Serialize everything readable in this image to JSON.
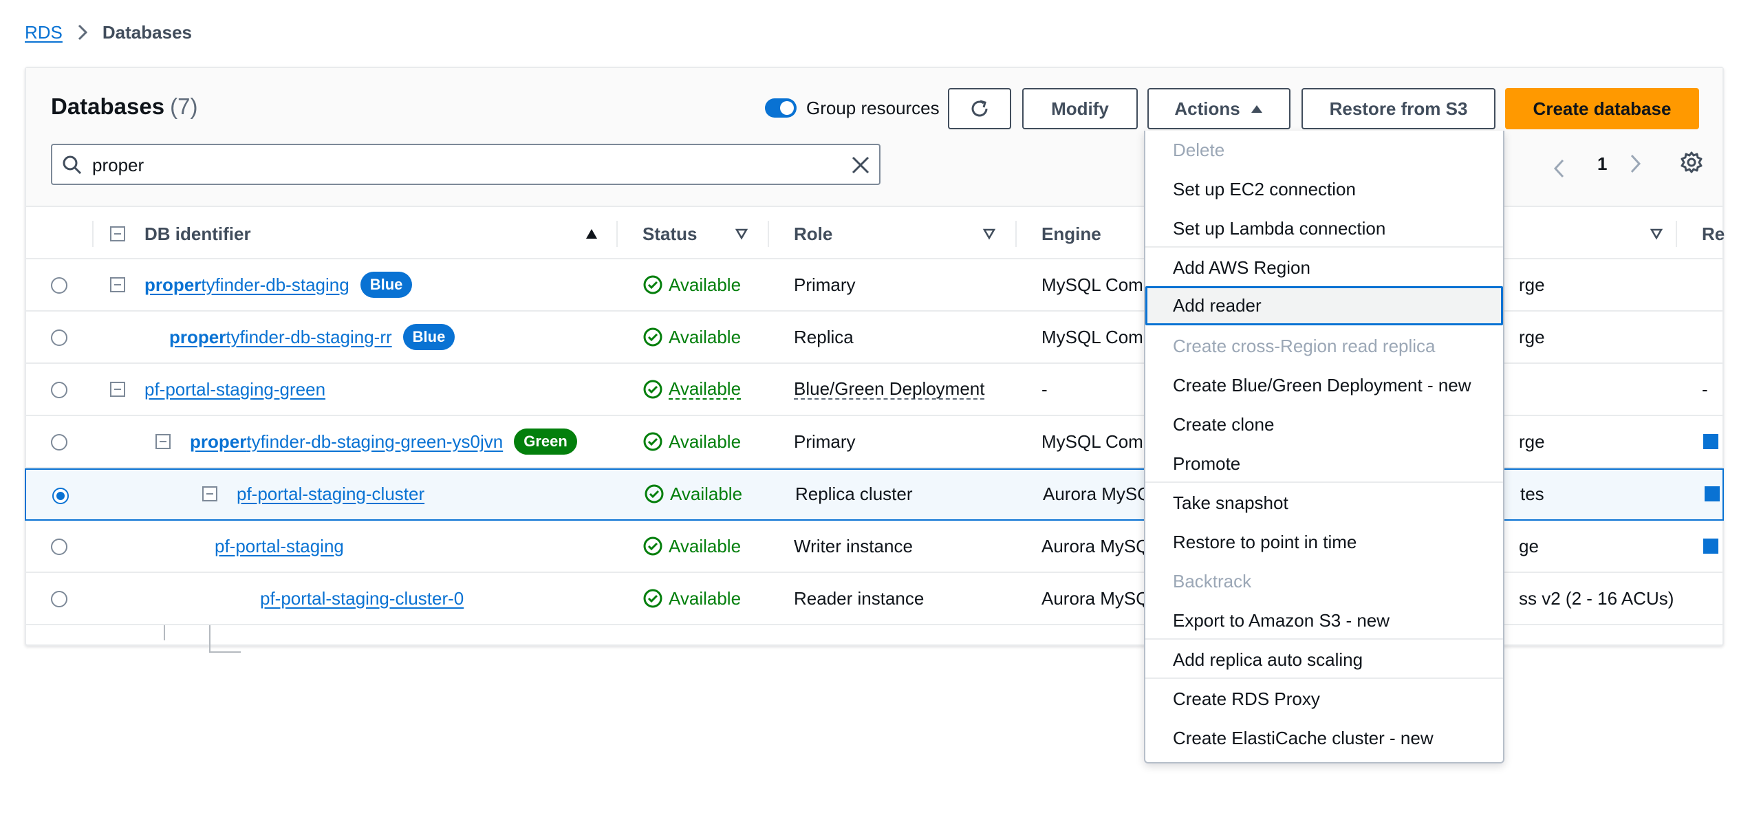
{
  "breadcrumb": {
    "root": "RDS",
    "current": "Databases"
  },
  "panel": {
    "title": "Databases",
    "count": "(7)",
    "group_toggle_label": "Group resources",
    "buttons": {
      "modify": "Modify",
      "actions": "Actions",
      "restore": "Restore from S3",
      "create": "Create database"
    },
    "search_value": "proper",
    "page": "1"
  },
  "columns": {
    "identifier": "DB identifier",
    "status": "Status",
    "role": "Role",
    "engine": "Engine",
    "region": "Re"
  },
  "rows": [
    {
      "id_bold": "proper",
      "id_rest": "tyfinder-db-staging",
      "badge": "Blue",
      "status": "Available",
      "role": "Primary",
      "engine": "MySQL Comm",
      "size": "rge",
      "region": ""
    },
    {
      "id_bold": "proper",
      "id_rest": "tyfinder-db-staging-rr",
      "badge": "Blue",
      "status": "Available",
      "role": "Replica",
      "engine": "MySQL Comm",
      "size": "rge",
      "region": ""
    },
    {
      "id_bold": "",
      "id_rest": "pf-portal-staging-green",
      "badge": "",
      "status": "Available",
      "role": "Blue/Green Deployment",
      "engine": "-",
      "size": "",
      "region": "-"
    },
    {
      "id_bold": "proper",
      "id_rest": "tyfinder-db-staging-green-ys0jvn",
      "badge": "Green",
      "status": "Available",
      "role": "Primary",
      "engine": "MySQL Comm",
      "size": "rge",
      "region": ""
    },
    {
      "id_bold": "",
      "id_rest": "pf-portal-staging-cluster",
      "badge": "",
      "status": "Available",
      "role": "Replica cluster",
      "engine": "Aurora MySQ",
      "size": "tes",
      "region": ""
    },
    {
      "id_bold": "",
      "id_rest": "pf-portal-staging",
      "badge": "",
      "status": "Available",
      "role": "Writer instance",
      "engine": "Aurora MySQ",
      "size": "ge",
      "region": ""
    },
    {
      "id_bold": "",
      "id_rest": "pf-portal-staging-cluster-0",
      "badge": "",
      "status": "Available",
      "role": "Reader instance",
      "engine": "Aurora MySQ",
      "size": "ss v2 (2 - 16 ACUs)",
      "region": ""
    }
  ],
  "actions_menu": [
    {
      "label": "Delete",
      "disabled": true
    },
    {
      "label": "Set up EC2 connection",
      "disabled": false
    },
    {
      "label": "Set up Lambda connection",
      "disabled": false
    },
    {
      "label": "Add AWS Region",
      "disabled": false
    },
    {
      "label": "Add reader",
      "disabled": false,
      "focused": true
    },
    {
      "label": "Create cross-Region read replica",
      "disabled": true
    },
    {
      "label": "Create Blue/Green Deployment - new",
      "disabled": false
    },
    {
      "label": "Create clone",
      "disabled": false
    },
    {
      "label": "Promote",
      "disabled": false
    },
    {
      "label": "Take snapshot",
      "disabled": false
    },
    {
      "label": "Restore to point in time",
      "disabled": false
    },
    {
      "label": "Backtrack",
      "disabled": true
    },
    {
      "label": "Export to Amazon S3 - new",
      "disabled": false
    },
    {
      "label": "Add replica auto scaling",
      "disabled": false
    },
    {
      "label": "Create RDS Proxy",
      "disabled": false
    },
    {
      "label": "Create ElastiCache cluster - new",
      "disabled": false
    }
  ],
  "colors": {
    "link": "#0972d3",
    "primary_button": "#ff9900",
    "success": "#037f0c",
    "disabled_text": "#9ba7b6"
  },
  "icons": [
    "chevron-right-icon",
    "refresh-icon",
    "caret-up-icon",
    "search-icon",
    "close-icon",
    "chevron-left-icon",
    "settings-icon",
    "sort-icon",
    "check-circle-icon",
    "tree-collapse-icon"
  ]
}
